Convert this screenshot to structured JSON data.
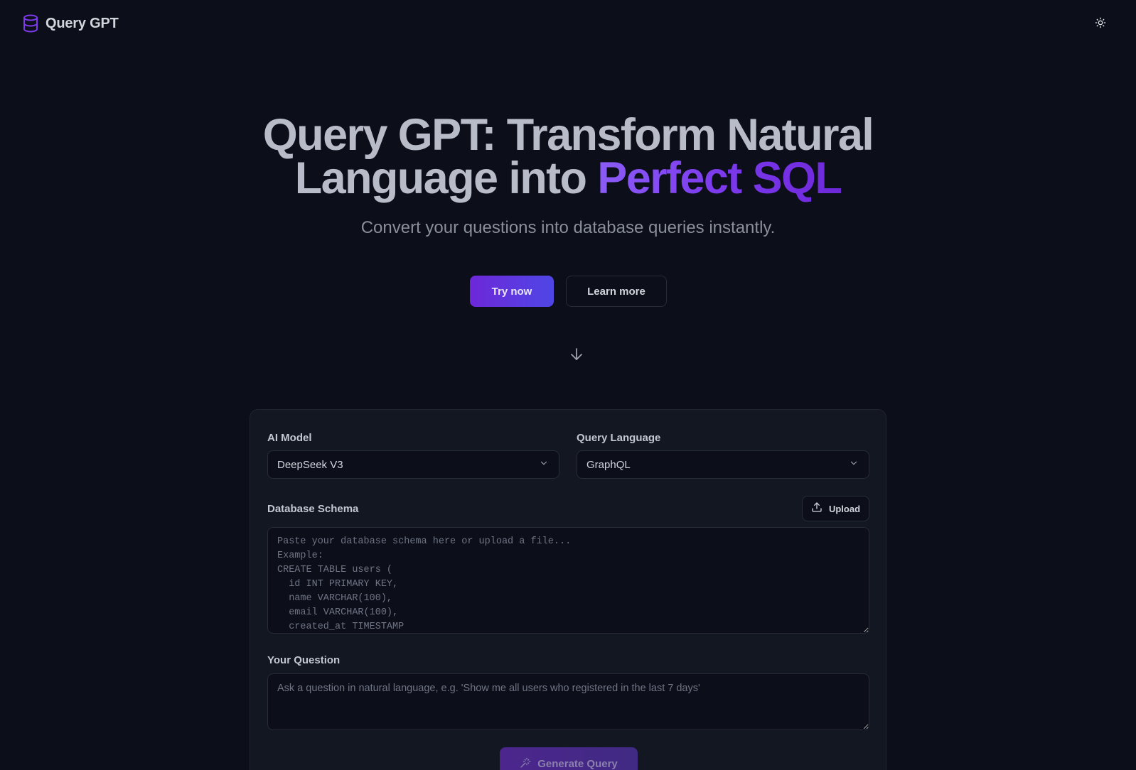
{
  "header": {
    "brand_name": "Query GPT",
    "logo_icon": "database-icon",
    "theme_toggle_icon": "sun-icon"
  },
  "hero": {
    "title_line1": "Query GPT: Transform Natural",
    "title_line2_plain": "Language into ",
    "title_line2_accent": "Perfect SQL",
    "subtitle": "Convert your questions into database queries instantly.",
    "primary_cta": "Try now",
    "secondary_cta": "Learn more",
    "scroll_icon": "arrow-down-icon"
  },
  "form": {
    "ai_model": {
      "label": "AI Model",
      "selected": "DeepSeek V3"
    },
    "query_language": {
      "label": "Query Language",
      "selected": "GraphQL"
    },
    "schema": {
      "label": "Database Schema",
      "upload_label": "Upload",
      "upload_icon": "upload-icon",
      "placeholder": "Paste your database schema here or upload a file...\nExample:\nCREATE TABLE users (\n  id INT PRIMARY KEY,\n  name VARCHAR(100),\n  email VARCHAR(100),\n  created_at TIMESTAMP\n);"
    },
    "question": {
      "label": "Your Question",
      "placeholder": "Ask a question in natural language, e.g. 'Show me all users who registered in the last 7 days'"
    },
    "generate_label": "Generate Query",
    "generate_icon": "magic-wand-icon"
  },
  "colors": {
    "background": "#0c0e19",
    "card": "#131722",
    "accent": "#7c3aed",
    "accent_secondary": "#4f46e5"
  }
}
